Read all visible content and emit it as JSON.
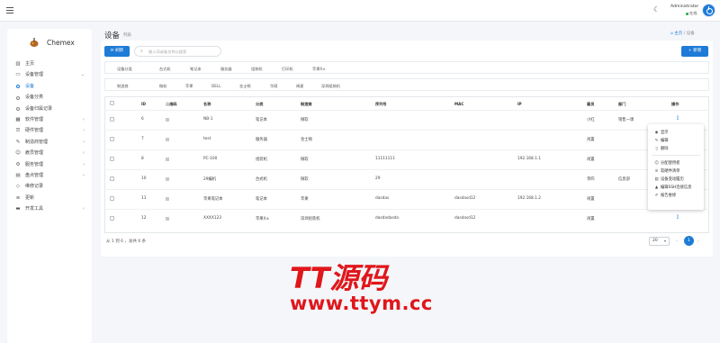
{
  "header": {
    "user_name": "Administrator",
    "user_status": "在线"
  },
  "sidebar": {
    "app_name": "Chemex",
    "items": [
      {
        "label": "主页",
        "icon": "bar-chart-icon",
        "caret": false
      },
      {
        "label": "设备管理",
        "icon": "monitor-icon",
        "caret": true
      },
      {
        "label": "设备",
        "sub": true,
        "active": true
      },
      {
        "label": "设备分类",
        "sub": true
      },
      {
        "label": "设备归属记录",
        "sub": true
      },
      {
        "label": "软件管理",
        "icon": "grid-icon",
        "caret": true
      },
      {
        "label": "硬件管理",
        "icon": "server-icon",
        "caret": true
      },
      {
        "label": "制造商管理",
        "icon": "tool-icon",
        "caret": true
      },
      {
        "label": "雇员管理",
        "icon": "users-icon",
        "caret": true
      },
      {
        "label": "服务管理",
        "icon": "cog-icon",
        "caret": true
      },
      {
        "label": "盘点管理",
        "icon": "clipboard-icon",
        "caret": true
      },
      {
        "label": "维修记录",
        "icon": "shield-icon",
        "caret": false
      },
      {
        "label": "更新",
        "icon": "list-icon",
        "caret": false
      },
      {
        "label": "开发工具",
        "icon": "keyboard-icon",
        "caret": true
      }
    ]
  },
  "page": {
    "title": "设备",
    "subtitle": "列表",
    "breadcrumb_home": "主页",
    "breadcrumb_sep": "/",
    "breadcrumb_current": "设备"
  },
  "toolbar": {
    "refresh_label": "刷新",
    "search_placeholder": "输入ID或者名称以搜索",
    "add_label": "新增"
  },
  "filters": {
    "category": [
      "设备分类",
      "台式机",
      "笔记本",
      "服务器",
      "组装机",
      "打印机",
      "苹果X±"
    ],
    "vendor": [
      "制造商",
      "微软",
      "苹果",
      "DELL",
      "金士顿",
      "华硕",
      "闽星",
      "深圳组装机"
    ]
  },
  "table": {
    "columns": [
      "ID",
      "二维码",
      "名称",
      "分类",
      "制造商",
      "序列号",
      "MAC",
      "IP",
      "雇员",
      "部门",
      "操作"
    ],
    "rows": [
      {
        "id": "6",
        "name": "NB-1",
        "category": "笔记本",
        "vendor": "微软",
        "serial": "",
        "mac": "",
        "ip": "",
        "staff": "小红",
        "dept": "销售一课"
      },
      {
        "id": "7",
        "name": "test",
        "category": "服务器",
        "vendor": "金士顿",
        "serial": "",
        "mac": "",
        "ip": "",
        "staff": "闲置",
        "dept": ""
      },
      {
        "id": "8",
        "name": "PC-100",
        "category": "组装机",
        "vendor": "微软",
        "serial": "11111111",
        "mac": "",
        "ip": "192.168.1.1",
        "staff": "闲置",
        "dept": ""
      },
      {
        "id": "10",
        "name": "29编机",
        "category": "台式机",
        "vendor": "微软",
        "serial": "29",
        "mac": "",
        "ip": "",
        "staff": "李四",
        "dept": "信息部"
      },
      {
        "id": "11",
        "name": "苹果笔记本",
        "category": "笔记本",
        "vendor": "苹果",
        "serial": "dasdas",
        "mac": "dasdasd12",
        "ip": "192.168.1.2",
        "staff": "闲置",
        "dept": ""
      },
      {
        "id": "12",
        "name": "XXXX123",
        "category": "苹果X±",
        "vendor": "深圳组装机",
        "serial": "dasdadasda",
        "mac": "dasdasd12",
        "ip": "",
        "staff": "闲置",
        "dept": ""
      }
    ]
  },
  "footer": {
    "info": "从 1 到 6 ，总共 6 条",
    "page_size": "20",
    "current_page": "1"
  },
  "dropdown": {
    "items": [
      "显示",
      "编辑",
      "删除",
      "分配使用者",
      "软硬件清单",
      "设备变动履历",
      "编辑SSH连接信息",
      "报告维修"
    ]
  },
  "watermark": {
    "title": "TT源码",
    "url": "www.ttym.cc"
  },
  "colors": {
    "accent": "#1e7bd6",
    "online": "#28a745",
    "watermark": "#e0161b"
  }
}
